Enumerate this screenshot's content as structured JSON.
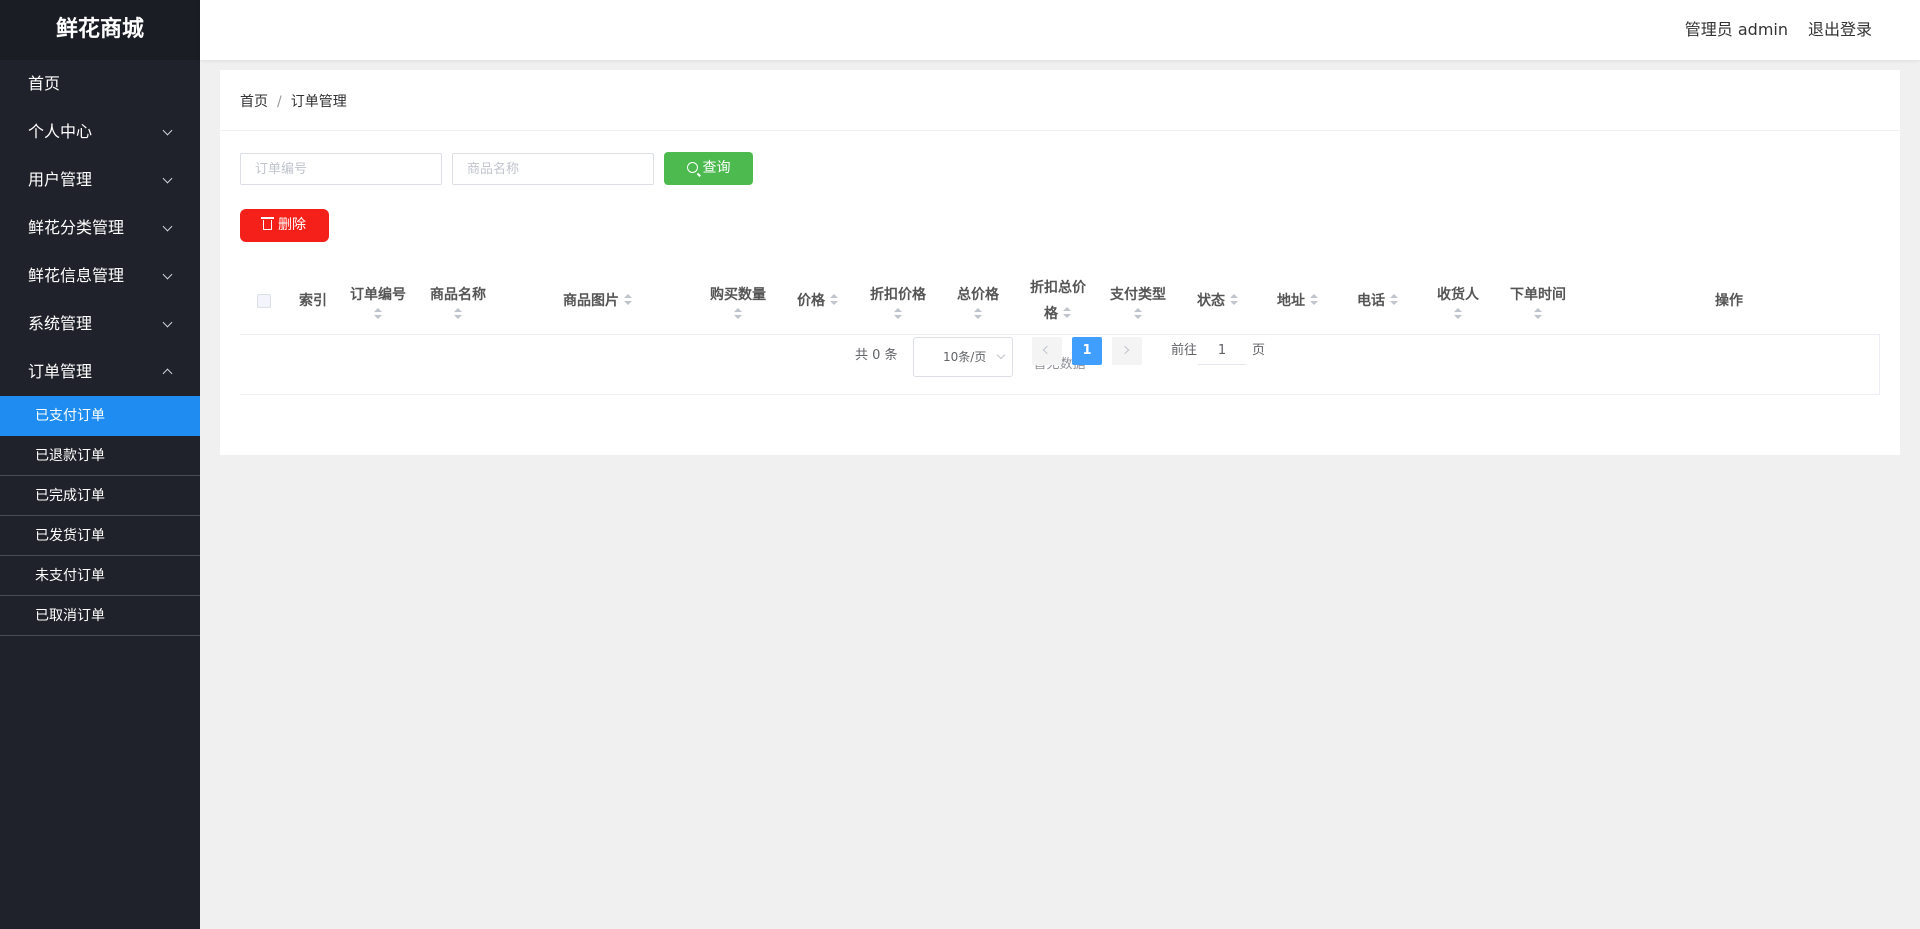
{
  "brand": "鲜花商城",
  "sidebar": {
    "home": "首页",
    "menus": [
      {
        "label": "个人中心"
      },
      {
        "label": "用户管理"
      },
      {
        "label": "鲜花分类管理"
      },
      {
        "label": "鲜花信息管理"
      },
      {
        "label": "系统管理"
      },
      {
        "label": "订单管理"
      }
    ],
    "order_submenu": [
      {
        "label": "已支付订单",
        "active": true
      },
      {
        "label": "已退款订单"
      },
      {
        "label": "已完成订单"
      },
      {
        "label": "已发货订单"
      },
      {
        "label": "未支付订单"
      },
      {
        "label": "已取消订单"
      }
    ]
  },
  "header": {
    "admin": "管理员 admin",
    "logout": "退出登录"
  },
  "breadcrumb": {
    "home": "首页",
    "sep": "/",
    "current": "订单管理"
  },
  "search": {
    "order_no_placeholder": "订单编号",
    "product_name_placeholder": "商品名称",
    "query_label": "查询"
  },
  "actions": {
    "delete_label": "删除"
  },
  "table": {
    "columns": {
      "index": "索引",
      "order_no": "订单编号",
      "product_name": "商品名称",
      "product_image": "商品图片",
      "quantity": "购买数量",
      "price": "价格",
      "discount_price_a": "折扣价格",
      "total_price": "总价格",
      "discount_total_a": "折扣总价",
      "discount_total_b": "格",
      "pay_type": "支付类型",
      "status": "状态",
      "address": "地址",
      "phone": "电话",
      "receiver": "收货人",
      "order_time": "下单时间",
      "operation": "操作"
    },
    "empty_text": "暂无数据"
  },
  "pagination": {
    "total": "共 0 条",
    "page_size": "10条/页",
    "current_page": "1",
    "goto_prefix": "前往",
    "goto_value": "1",
    "goto_suffix": "页"
  },
  "colors": {
    "sidebar_bg": "#1f222a",
    "active_menu": "#1e8cf0",
    "query_button": "#4dba50",
    "delete_button": "#f5201a",
    "page_active": "#409eff"
  }
}
